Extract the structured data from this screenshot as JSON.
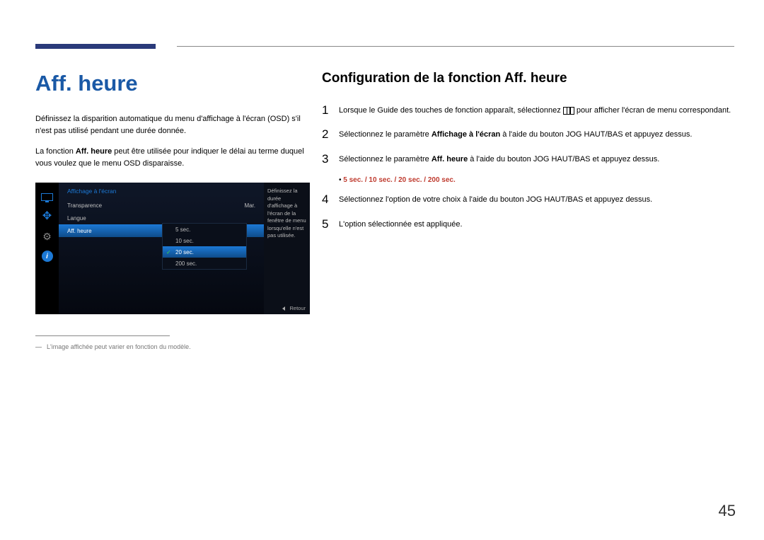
{
  "header": {
    "page_title": "Aff. heure",
    "sub_title": "Configuration de la fonction Aff. heure"
  },
  "left": {
    "intro1": "Définissez la disparition automatique du menu d'affichage à l'écran (OSD) s'il n'est pas utilisé pendant une durée donnée.",
    "intro2_a": "La fonction ",
    "intro2_bold": "Aff. heure",
    "intro2_b": " peut être utilisée pour indiquer le délai au terme duquel vous voulez que le menu OSD disparaisse.",
    "footnote": "L'image affichée peut varier en fonction du modèle."
  },
  "osd": {
    "title": "Affichage à l'écran",
    "rows": [
      {
        "label": "Transparence",
        "value": "Mar."
      },
      {
        "label": "Langue",
        "value": ""
      },
      {
        "label": "Aff. heure",
        "value": "",
        "selected": true
      }
    ],
    "sub_options": [
      {
        "label": "5 sec."
      },
      {
        "label": "10 sec."
      },
      {
        "label": "20 sec.",
        "selected": true
      },
      {
        "label": "200 sec."
      }
    ],
    "help": "Définissez la durée d'affichage à l'écran de la fenêtre de menu lorsqu'elle n'est pas utilisée.",
    "back": "Retour"
  },
  "steps": {
    "s1a": "Lorsque le Guide des touches de fonction apparaît, sélectionnez ",
    "s1b": " pour afficher l'écran de menu correspondant.",
    "s2a": "Sélectionnez le paramètre ",
    "s2bold": "Affichage à l'écran",
    "s2b": " à l'aide du bouton JOG HAUT/BAS et appuyez dessus.",
    "s3a": "Sélectionnez le paramètre ",
    "s3bold": "Aff. heure",
    "s3b": " à l'aide du bouton JOG HAUT/BAS et appuyez dessus.",
    "options": "5 sec. / 10 sec. / 20 sec. / 200 sec.",
    "s4": "Sélectionnez l'option de votre choix à l'aide du bouton JOG HAUT/BAS et appuyez dessus.",
    "s5": "L'option sélectionnée est appliquée."
  },
  "page_number": "45"
}
